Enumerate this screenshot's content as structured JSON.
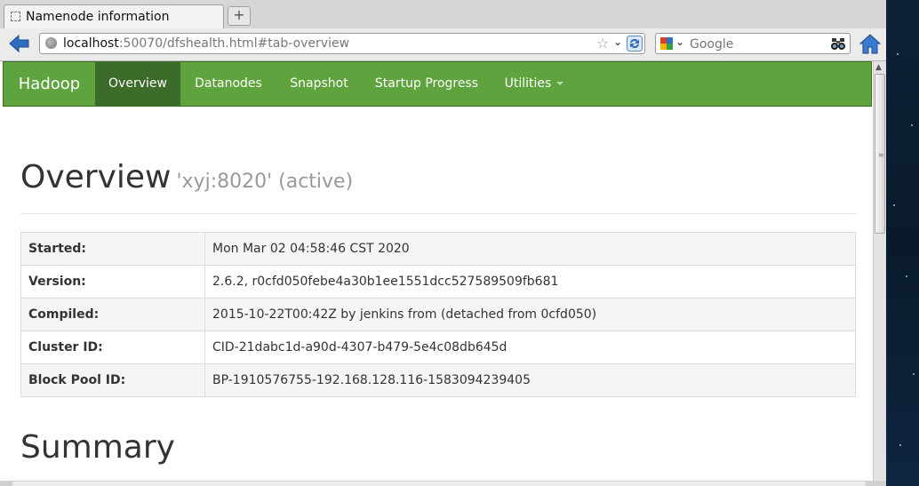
{
  "window": {
    "tab_title": "Namenode information",
    "new_tab_symbol": "+"
  },
  "navbar": {
    "url_host": "localhost",
    "url_rest": ":50070/dfshealth.html#tab-overview",
    "search_placeholder": "Google"
  },
  "hadoop_nav": {
    "brand": "Hadoop",
    "items": [
      {
        "label": "Overview",
        "active": true
      },
      {
        "label": "Datanodes",
        "active": false
      },
      {
        "label": "Snapshot",
        "active": false
      },
      {
        "label": "Startup Progress",
        "active": false
      },
      {
        "label": "Utilities",
        "active": false,
        "dropdown": true
      }
    ],
    "colors": {
      "bar": "#5fa33e",
      "active": "#3c6b2a"
    }
  },
  "overview": {
    "title": "Overview",
    "subtitle": "'xyj:8020' (active)",
    "rows": [
      {
        "key": "Started:",
        "value": "Mon Mar 02 04:58:46 CST 2020"
      },
      {
        "key": "Version:",
        "value": "2.6.2, r0cfd050febe4a30b1ee1551dcc527589509fb681"
      },
      {
        "key": "Compiled:",
        "value": "2015-10-22T00:42Z by jenkins from (detached from 0cfd050)"
      },
      {
        "key": "Cluster ID:",
        "value": "CID-21dabc1d-a90d-4307-b479-5e4c08db645d"
      },
      {
        "key": "Block Pool ID:",
        "value": "BP-1910576755-192.168.128.116-1583094239405"
      }
    ]
  },
  "summary": {
    "title": "Summary"
  }
}
